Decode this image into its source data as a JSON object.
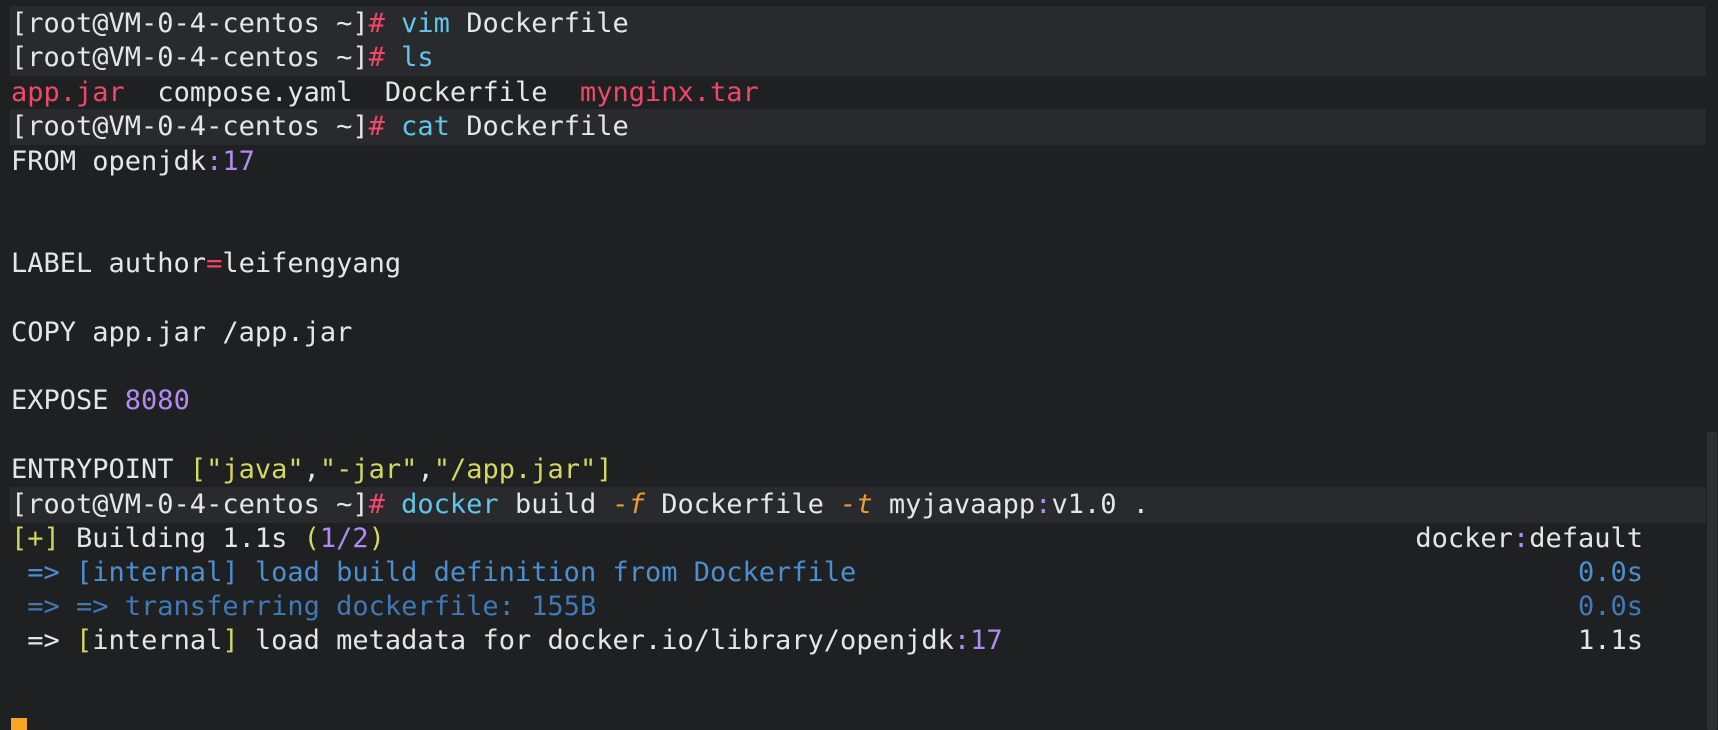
{
  "terminal": {
    "prompt": "[root@VM-0-4-centos ~]",
    "hash": "#",
    "cmd1": {
      "verb": "vim",
      "arg": " Dockerfile"
    },
    "cmd2": {
      "verb": "ls"
    },
    "ls_output": {
      "f1": "app.jar",
      "f2": "compose.yaml",
      "f3": "Dockerfile",
      "f4": "mynginx.tar"
    },
    "cmd3": {
      "verb": "cat",
      "arg": " Dockerfile"
    },
    "dockerfile": {
      "from_kw": "FROM openjdk",
      "from_colon": ":",
      "from_tag": "17",
      "label_kw": "LABEL author",
      "label_eq": "=",
      "label_val": "leifengyang",
      "copy_line": "COPY app.jar /app.jar",
      "expose_kw": "EXPOSE ",
      "expose_port": "8080",
      "entry_kw": "ENTRYPOINT ",
      "entry_open": "[",
      "entry_a": "\"java\"",
      "entry_comma1": ",",
      "entry_b": "\"-jar\"",
      "entry_comma2": ",",
      "entry_c": "\"/app.jar\"",
      "entry_close": "]"
    },
    "cmd4": {
      "verb": "docker",
      "part1": " build ",
      "flag_f": "-f",
      "part2": " Dockerfile ",
      "flag_t": "-t",
      "part3": " myjavaapp",
      "colon": ":",
      "part4": "v1.0 ."
    },
    "build": {
      "plus": "[+]",
      "text": " Building 1.1s ",
      "paren_open": "(",
      "progress": "1/2",
      "paren_close": ")",
      "context_a": "docker",
      "context_colon": ":",
      "context_b": "default",
      "step1": " => [internal] load build definition from Dockerfile",
      "step1_time": "0.0s",
      "step2": " => => transferring dockerfile: 155B",
      "step2_time": "0.0s",
      "step3_arrow": " => ",
      "step3_bracket_open": "[",
      "step3_internal": "internal",
      "step3_bracket_close": "]",
      "step3_text": " load metadata for docker.io/library/openjdk",
      "step3_colon": ":",
      "step3_tag": "17",
      "step3_time": "1.1s"
    }
  },
  "colors": {
    "background": "#1f2022",
    "prompt_hash": "#ef4869",
    "command": "#5fc7e8",
    "number": "#b08cf2",
    "flag": "#f09a36",
    "progress_dim": "#4c8fd1"
  }
}
